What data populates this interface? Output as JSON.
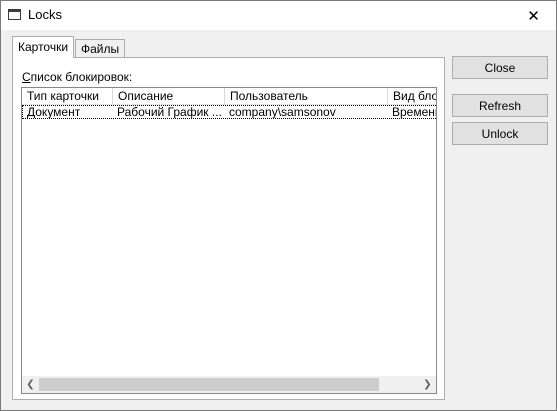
{
  "window": {
    "title": "Locks",
    "close_glyph": "✕"
  },
  "tabs": [
    {
      "label": "Карточки",
      "active": true
    },
    {
      "label": "Файлы",
      "active": false
    }
  ],
  "list": {
    "label_first": "С",
    "label_rest": "писок блокировок:",
    "columns": [
      "Тип карточки",
      "Описание",
      "Пользователь",
      "Вид блокировки"
    ],
    "rows": [
      [
        "Документ",
        "Рабочий График ...",
        "company\\samsonov",
        "Временная"
      ]
    ]
  },
  "buttons": {
    "close": "Close",
    "refresh": "Refresh",
    "unlock": "Unlock"
  },
  "scroll": {
    "left_arrow": "❮",
    "right_arrow": "❯"
  }
}
